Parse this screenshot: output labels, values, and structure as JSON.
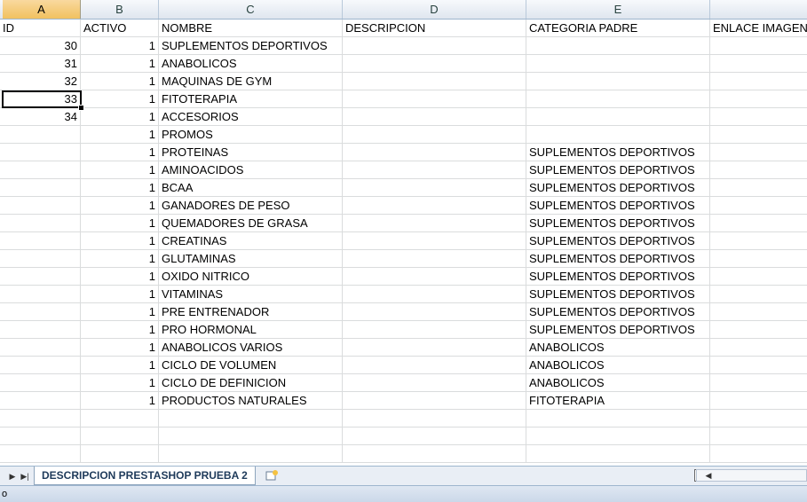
{
  "columns": [
    "A",
    "B",
    "C",
    "D",
    "E",
    ""
  ],
  "selected_column": "A",
  "header_row": [
    "ID",
    "ACTIVO",
    "NOMBRE",
    "DESCRIPCION",
    "CATEGORIA PADRE",
    "ENLACE IMAGEN"
  ],
  "rows": [
    [
      "30",
      "1",
      "SUPLEMENTOS DEPORTIVOS",
      "",
      ""
    ],
    [
      "31",
      "1",
      "ANABOLICOS",
      "",
      ""
    ],
    [
      "32",
      "1",
      "MAQUINAS DE GYM",
      "",
      ""
    ],
    [
      "33",
      "1",
      "FITOTERAPIA",
      "",
      ""
    ],
    [
      "34",
      "1",
      "ACCESORIOS",
      "",
      ""
    ],
    [
      "",
      "1",
      "PROMOS",
      "",
      ""
    ],
    [
      "",
      "1",
      "PROTEINAS",
      "",
      "SUPLEMENTOS DEPORTIVOS"
    ],
    [
      "",
      "1",
      "AMINOACIDOS",
      "",
      "SUPLEMENTOS DEPORTIVOS"
    ],
    [
      "",
      "1",
      "BCAA",
      "",
      "SUPLEMENTOS DEPORTIVOS"
    ],
    [
      "",
      "1",
      "GANADORES DE PESO",
      "",
      "SUPLEMENTOS DEPORTIVOS"
    ],
    [
      "",
      "1",
      "QUEMADORES DE GRASA",
      "",
      "SUPLEMENTOS DEPORTIVOS"
    ],
    [
      "",
      "1",
      "CREATINAS",
      "",
      "SUPLEMENTOS DEPORTIVOS"
    ],
    [
      "",
      "1",
      "GLUTAMINAS",
      "",
      "SUPLEMENTOS DEPORTIVOS"
    ],
    [
      "",
      "1",
      "OXIDO NITRICO",
      "",
      "SUPLEMENTOS DEPORTIVOS"
    ],
    [
      "",
      "1",
      "VITAMINAS",
      "",
      "SUPLEMENTOS DEPORTIVOS"
    ],
    [
      "",
      "1",
      "PRE ENTRENADOR",
      "",
      "SUPLEMENTOS DEPORTIVOS"
    ],
    [
      "",
      "1",
      "PRO HORMONAL",
      "",
      "SUPLEMENTOS DEPORTIVOS"
    ],
    [
      "",
      "1",
      "ANABOLICOS VARIOS",
      "",
      "ANABOLICOS"
    ],
    [
      "",
      "1",
      "CICLO DE VOLUMEN",
      "",
      "ANABOLICOS"
    ],
    [
      "",
      "1",
      "CICLO DE DEFINICION",
      "",
      "ANABOLICOS"
    ],
    [
      "",
      "1",
      "PRODUCTOS NATURALES",
      "",
      "FITOTERAPIA"
    ],
    [
      "",
      "",
      "",
      "",
      ""
    ],
    [
      "",
      "",
      "",
      "",
      ""
    ],
    [
      "",
      "",
      "",
      "",
      ""
    ]
  ],
  "sheet_tab": "DESCRIPCION PRESTASHOP PRUEBA 2",
  "status_text": "o",
  "colors": {
    "header_bg": "#dfe6ef",
    "selected_header": "#f1c15f",
    "grid_line": "#dadcdd"
  }
}
